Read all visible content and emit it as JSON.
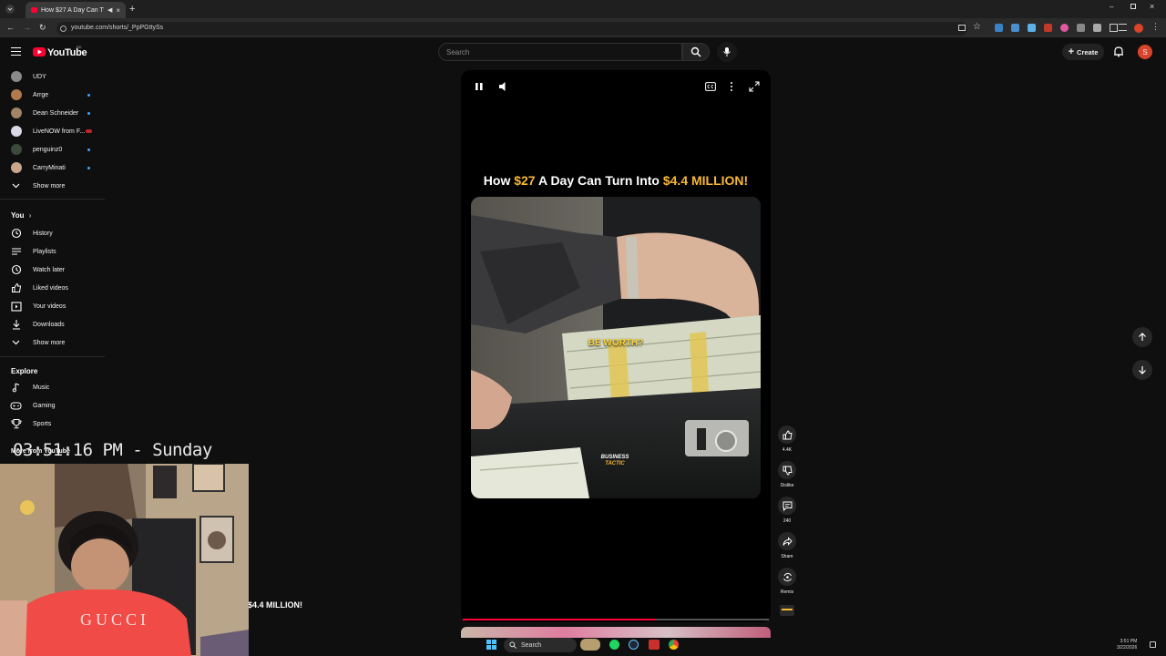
{
  "browser": {
    "tab_title": "How $27 A Day Can Turn In",
    "url": "youtube.com/shorts/_PpPGttySs"
  },
  "masthead": {
    "logo": "YouTube",
    "logo_region": "BD",
    "search_placeholder": "Search",
    "create_label": "Create",
    "avatar_letter": "S"
  },
  "sidebar": {
    "subscriptions": [
      {
        "label": "UDY",
        "color": "#8a8a8a",
        "dot": false
      },
      {
        "label": "Arrge",
        "color": "#b07a4c",
        "dot": true
      },
      {
        "label": "Dean Schneider",
        "color": "#a18566",
        "dot": true
      },
      {
        "label": "LiveNOW from F...",
        "color": "#d9d9e6",
        "dot": false,
        "live": true
      },
      {
        "label": "penguinz0",
        "color": "#3b4a3a",
        "dot": true
      },
      {
        "label": "CarryMinati",
        "color": "#c9a58b",
        "dot": true
      }
    ],
    "subs_show_more": "Show more",
    "you_title": "You",
    "you_items": [
      {
        "label": "History",
        "icon": "history-icon"
      },
      {
        "label": "Playlists",
        "icon": "playlists-icon"
      },
      {
        "label": "Watch later",
        "icon": "watch-later-icon"
      },
      {
        "label": "Liked videos",
        "icon": "thumbs-up-icon"
      },
      {
        "label": "Your videos",
        "icon": "your-videos-icon"
      },
      {
        "label": "Downloads",
        "icon": "download-icon"
      }
    ],
    "you_show_more": "Show more",
    "explore_title": "Explore",
    "explore_items": [
      {
        "label": "Music",
        "icon": "music-icon"
      },
      {
        "label": "Gaming",
        "icon": "gaming-icon"
      },
      {
        "label": "Sports",
        "icon": "trophy-icon"
      }
    ],
    "more_from_title": "More from YouTube"
  },
  "short": {
    "title_part1": "How ",
    "title_amount1": "$27",
    "title_part2": " A Day Can Turn Into ",
    "title_amount2": "$4.4 MILLION!",
    "caption": "BE WORTH?",
    "watermark_line1": "BUSINESS",
    "watermark_line2": "TACTIC",
    "progress": 0.63,
    "accent": "#f6b733"
  },
  "actions": {
    "like_count": "4.4K",
    "dislike_label": "Dislike",
    "comment_count": "240",
    "share_label": "Share",
    "remix_label": "Remix"
  },
  "overlay": {
    "clock": "03:51:16 PM - Sunday",
    "shirt_text": "GUCCI",
    "background_title": "$4.4 MILLION!"
  },
  "taskbar": {
    "search_label": "Search",
    "time": "3:51 PM",
    "date": "3/22/2026"
  }
}
